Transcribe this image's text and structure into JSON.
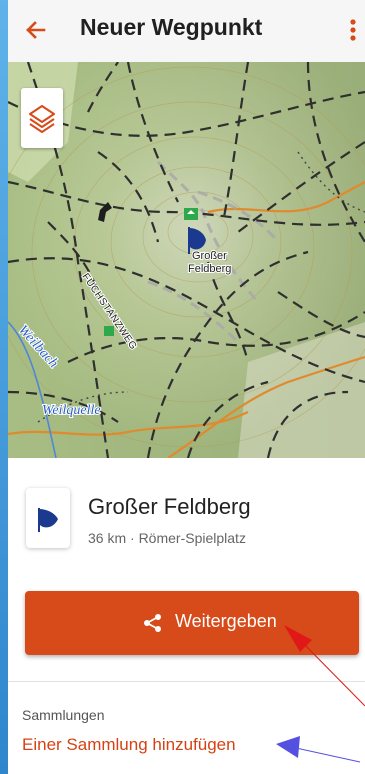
{
  "header": {
    "title": "Neuer Wegpunkt"
  },
  "map": {
    "labels": {
      "peak": [
        "Großer",
        "Feldberg"
      ],
      "path": "FUCHSTANZWEG",
      "stream": "Weilbach",
      "spring": "Weilquelle"
    }
  },
  "waypoint": {
    "name": "Großer Feldberg",
    "subtitle": "36 km · Römer-Spielplatz"
  },
  "actions": {
    "share_label": "Weitergeben"
  },
  "collections": {
    "heading": "Sammlungen",
    "add_link": "Einer Sammlung hinzufügen"
  },
  "colors": {
    "accent": "#d74a1a",
    "link": "#d64213",
    "flag": "#1b3a8f",
    "frame": "#2a8fd6"
  }
}
